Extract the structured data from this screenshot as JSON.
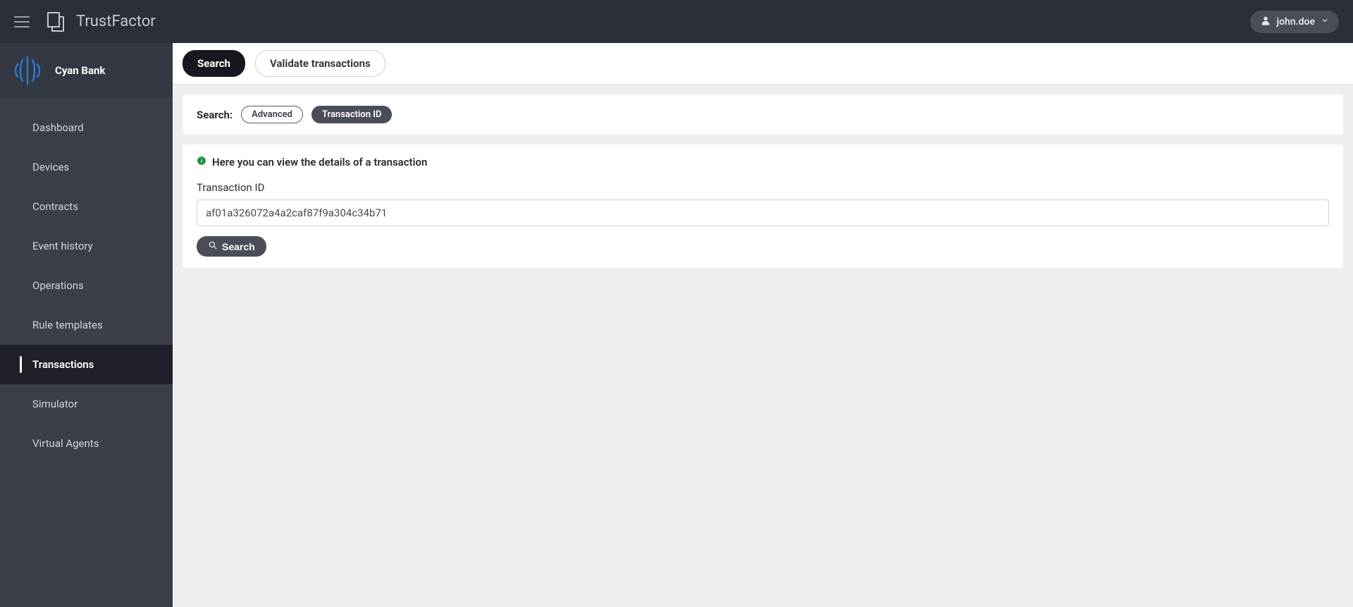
{
  "header": {
    "app_title": "TrustFactor",
    "username": "john.doe"
  },
  "sidebar": {
    "org_name": "Cyan Bank",
    "items": [
      {
        "label": "Dashboard",
        "active": false
      },
      {
        "label": "Devices",
        "active": false
      },
      {
        "label": "Contracts",
        "active": false
      },
      {
        "label": "Event history",
        "active": false
      },
      {
        "label": "Operations",
        "active": false
      },
      {
        "label": "Rule templates",
        "active": false
      },
      {
        "label": "Transactions",
        "active": true
      },
      {
        "label": "Simulator",
        "active": false
      },
      {
        "label": "Virtual Agents",
        "active": false
      }
    ]
  },
  "top_tabs": [
    {
      "label": "Search",
      "active": true
    },
    {
      "label": "Validate transactions",
      "active": false
    }
  ],
  "search_panel": {
    "label": "Search:",
    "chips": [
      {
        "label": "Advanced",
        "active": false
      },
      {
        "label": "Transaction ID",
        "active": true
      }
    ]
  },
  "form": {
    "info_text": "Here you can view the details of a transaction",
    "field_label": "Transaction ID",
    "input_value": "af01a326072a4a2caf87f9a304c34b71",
    "search_button": "Search"
  }
}
